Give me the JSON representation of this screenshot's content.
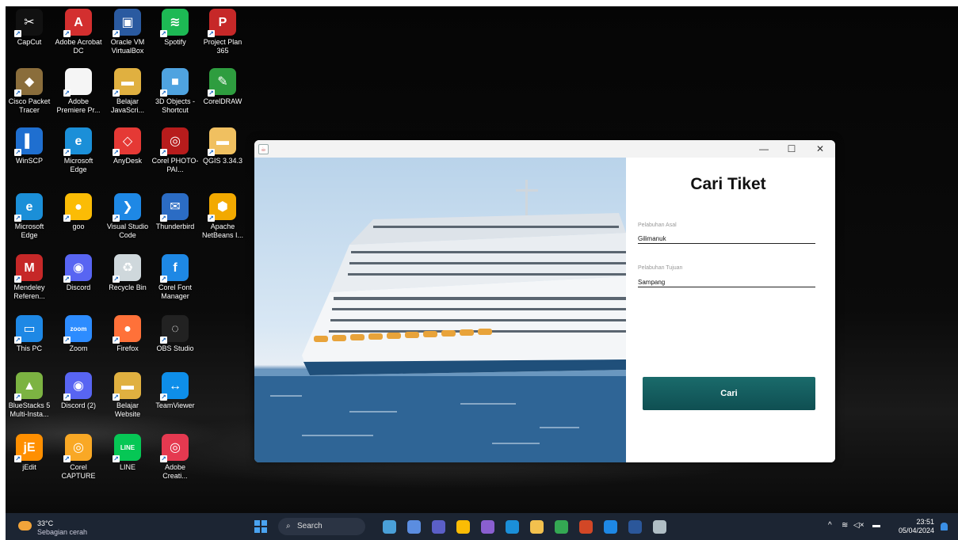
{
  "desktop": {
    "icons": [
      {
        "label": "CapCut",
        "color": "#111111",
        "glyph": "✂"
      },
      {
        "label": "Adobe Acrobat DC",
        "color": "#d32f2f",
        "glyph": "A"
      },
      {
        "label": "Oracle VM VirtualBox",
        "color": "#2a5aa0",
        "glyph": "▣"
      },
      {
        "label": "Spotify",
        "color": "#1db954",
        "glyph": "≋"
      },
      {
        "label": "Project Plan 365",
        "color": "#c62828",
        "glyph": "P"
      },
      {
        "label": "Cisco Packet Tracer",
        "color": "#8a6d3b",
        "glyph": "◆"
      },
      {
        "label": "Adobe Premiere Pr...",
        "color": "#f5f5f5",
        "glyph": ""
      },
      {
        "label": "Belajar JavaScri...",
        "color": "#e0b040",
        "glyph": "▬"
      },
      {
        "label": "3D Objects - Shortcut",
        "color": "#4fa3e0",
        "glyph": "■"
      },
      {
        "label": "CorelDRAW",
        "color": "#2e9d3f",
        "glyph": "✎"
      },
      {
        "label": "WinSCP",
        "color": "#1f6fd0",
        "glyph": "▌"
      },
      {
        "label": "Microsoft Edge",
        "color": "#1b8fd8",
        "glyph": "e"
      },
      {
        "label": "AnyDesk",
        "color": "#e53935",
        "glyph": "◇"
      },
      {
        "label": "Corel PHOTO-PAI...",
        "color": "#b71c1c",
        "glyph": "◎"
      },
      {
        "label": "QGIS 3.34.3",
        "color": "#f0c060",
        "glyph": "▬"
      },
      {
        "label": "Microsoft Edge",
        "color": "#1b8fd8",
        "glyph": "e"
      },
      {
        "label": "goo",
        "color": "#fbbc05",
        "glyph": "●"
      },
      {
        "label": "Visual Studio Code",
        "color": "#1e88e5",
        "glyph": "❯"
      },
      {
        "label": "Thunderbird",
        "color": "#2b6cc4",
        "glyph": "✉"
      },
      {
        "label": "Apache NetBeans I...",
        "color": "#f2a900",
        "glyph": "⬢"
      },
      {
        "label": "Mendeley Referen...",
        "color": "#c62828",
        "glyph": "M"
      },
      {
        "label": "Discord",
        "color": "#5865f2",
        "glyph": "◉"
      },
      {
        "label": "Recycle Bin",
        "color": "#cfd8dc",
        "glyph": "♻"
      },
      {
        "label": "Corel Font Manager",
        "color": "#1e88e5",
        "glyph": "f"
      },
      {
        "label": "This PC",
        "color": "#1e88e5",
        "glyph": "▭"
      },
      {
        "label": "Zoom",
        "color": "#2d8cff",
        "glyph": "zoom"
      },
      {
        "label": "Firefox",
        "color": "#ff7139",
        "glyph": "●"
      },
      {
        "label": "OBS Studio",
        "color": "#222222",
        "glyph": "◌"
      },
      {
        "label": "BlueStacks 5 Multi-Insta...",
        "color": "#7cb342",
        "glyph": "▲"
      },
      {
        "label": "Discord (2)",
        "color": "#5865f2",
        "glyph": "◉"
      },
      {
        "label": "Belajar Website",
        "color": "#e0b040",
        "glyph": "▬"
      },
      {
        "label": "TeamViewer",
        "color": "#0e8ee9",
        "glyph": "↔"
      },
      {
        "label": "jEdit",
        "color": "#ff8f00",
        "glyph": "jE"
      },
      {
        "label": "Corel CAPTURE",
        "color": "#f9a825",
        "glyph": "◎"
      },
      {
        "label": "LINE",
        "color": "#06c755",
        "glyph": "LINE"
      },
      {
        "label": "Adobe Creati...",
        "color": "#e53950",
        "glyph": "◎"
      }
    ]
  },
  "window": {
    "title_icon": "☕",
    "minimize": "—",
    "maximize": "☐",
    "close": "✕",
    "form": {
      "title": "Cari Tiket",
      "origin_label": "Pelabuhan Asal",
      "origin_value": "Gilimanuk",
      "dest_label": "Pelabuhan Tujuan",
      "dest_value": "Sampang",
      "search_button": "Cari"
    }
  },
  "taskbar": {
    "weather_temp": "33°C",
    "weather_cond": "Sebagian cerah",
    "search_placeholder": "Search",
    "search_glyph": "⌕",
    "apps": [
      {
        "name": "landscape",
        "color": "#4aa0d8"
      },
      {
        "name": "people",
        "color": "#5b8de0"
      },
      {
        "name": "teams",
        "color": "#5b5fc7"
      },
      {
        "name": "chrome",
        "color": "#fbbc05"
      },
      {
        "name": "visual-studio",
        "color": "#8a5fd0"
      },
      {
        "name": "edge",
        "color": "#1b8fd8"
      },
      {
        "name": "file-explorer",
        "color": "#f2c14e"
      },
      {
        "name": "chrome-2",
        "color": "#34a853"
      },
      {
        "name": "powerpoint",
        "color": "#d24726"
      },
      {
        "name": "netbeans",
        "color": "#1e88e5"
      },
      {
        "name": "word",
        "color": "#2b579a"
      },
      {
        "name": "java",
        "color": "#b0bec5"
      }
    ],
    "tray_chevron": "^",
    "tray_wifi": "≋",
    "tray_sound": "◁×",
    "tray_battery": "▬",
    "time": "23:51",
    "date": "05/04/2024"
  }
}
